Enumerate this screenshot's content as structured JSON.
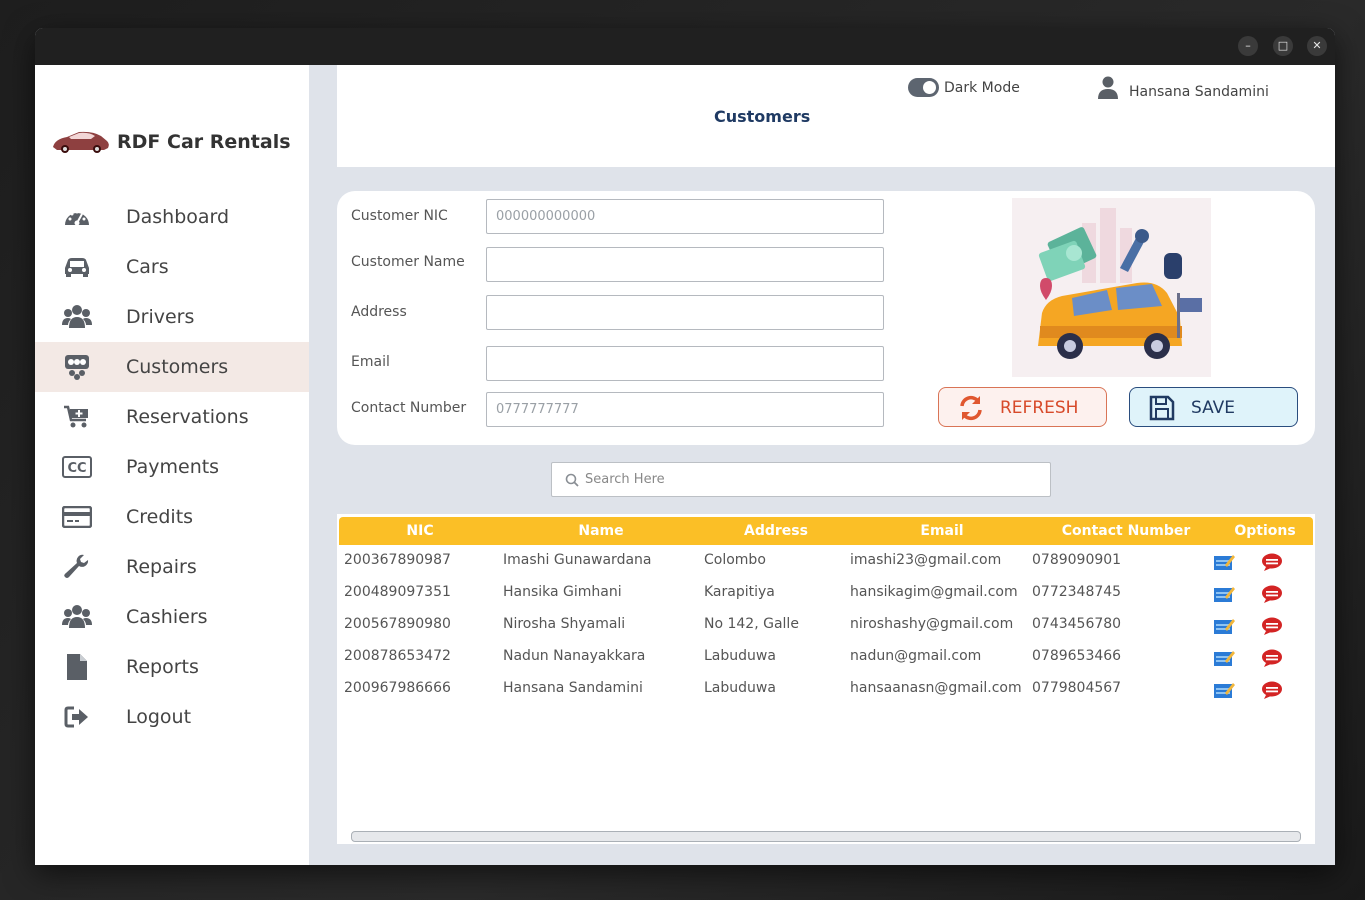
{
  "window": {
    "controls": [
      "–",
      "□",
      "✕"
    ]
  },
  "brand": {
    "name": "RDF Car Rentals"
  },
  "sidebar": {
    "items": [
      {
        "label": "Dashboard",
        "icon": "dashboard-icon",
        "active": false
      },
      {
        "label": "Cars",
        "icon": "car-icon",
        "active": false
      },
      {
        "label": "Drivers",
        "icon": "users-icon",
        "active": false
      },
      {
        "label": "Customers",
        "icon": "customer-icon",
        "active": true
      },
      {
        "label": "Reservations",
        "icon": "cart-plus-icon",
        "active": false
      },
      {
        "label": "Payments",
        "icon": "cc-icon",
        "active": false
      },
      {
        "label": "Credits",
        "icon": "credit-card-icon",
        "active": false
      },
      {
        "label": "Repairs",
        "icon": "wrench-icon",
        "active": false
      },
      {
        "label": "Cashiers",
        "icon": "users-icon",
        "active": false
      },
      {
        "label": "Reports",
        "icon": "file-icon",
        "active": false
      },
      {
        "label": "Logout",
        "icon": "logout-icon",
        "active": false
      }
    ]
  },
  "header": {
    "title": "Customers",
    "dark_mode_label": "Dark Mode",
    "dark_mode_on": true,
    "user_name": "Hansana Sandamini"
  },
  "form": {
    "nic": {
      "label": "Customer NIC",
      "placeholder": "000000000000",
      "value": ""
    },
    "name": {
      "label": "Customer Name",
      "placeholder": "",
      "value": ""
    },
    "address": {
      "label": "Address",
      "placeholder": "",
      "value": ""
    },
    "email": {
      "label": "Email",
      "placeholder": "",
      "value": ""
    },
    "contact": {
      "label": "Contact Number",
      "placeholder": "0777777777",
      "value": ""
    },
    "refresh_label": "REFRESH",
    "save_label": "SAVE"
  },
  "search": {
    "placeholder": "Search Here"
  },
  "table": {
    "columns": [
      "NIC",
      "Name",
      "Address",
      "Email",
      "Contact Number",
      "Options"
    ],
    "rows": [
      {
        "nic": "200367890987",
        "name": "Imashi Gunawardana",
        "address": "Colombo",
        "email": "imashi23@gmail.com",
        "contact": "0789090901"
      },
      {
        "nic": "200489097351",
        "name": "Hansika Gimhani",
        "address": "Karapitiya",
        "email": "hansikagim@gmail.com",
        "contact": "0772348745"
      },
      {
        "nic": "200567890980",
        "name": "Nirosha Shyamali",
        "address": "No 142, Galle",
        "email": "niroshashy@gmail.com",
        "contact": "0743456780"
      },
      {
        "nic": "200878653472",
        "name": "Nadun Nanayakkara",
        "address": "Labuduwa",
        "email": "nadun@gmail.com",
        "contact": "0789653466"
      },
      {
        "nic": "200967986666",
        "name": "Hansana Sandamini",
        "address": "Labuduwa",
        "email": "hansaanasn@gmail.com",
        "contact": "0779804567"
      }
    ]
  },
  "colors": {
    "accent": "#fbbf26",
    "title": "#1f3a63",
    "refresh": "#d74a2a",
    "save": "#203a62",
    "active_nav": "#f3e9e5"
  }
}
